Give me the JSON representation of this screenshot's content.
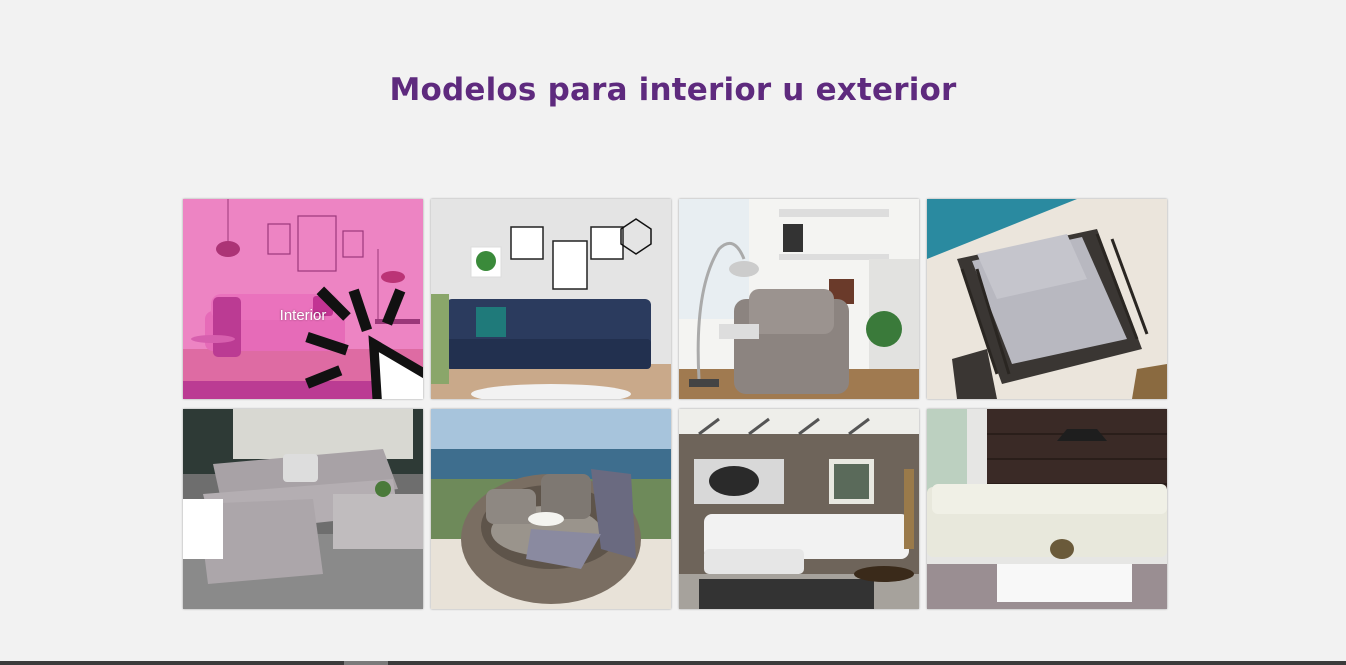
{
  "section": {
    "title": "Modelos para interior u exterior"
  },
  "tiles": [
    {
      "name": "living-room-pink",
      "hover_label": "Interior",
      "hovered": true
    },
    {
      "name": "blue-sofa-living-room"
    },
    {
      "name": "grey-armchair-reading"
    },
    {
      "name": "outdoor-armchair-pool"
    },
    {
      "name": "outdoor-sectional-patio"
    },
    {
      "name": "wicker-lounge-beach"
    },
    {
      "name": "white-sofa-stone-wall"
    },
    {
      "name": "white-sectional-dark-wall"
    }
  ],
  "colors": {
    "title": "#5e2a7e",
    "background": "#f2f2f2",
    "hover_overlay": "#f03cb4"
  },
  "icons": {
    "cursor": "click-cursor-icon"
  }
}
